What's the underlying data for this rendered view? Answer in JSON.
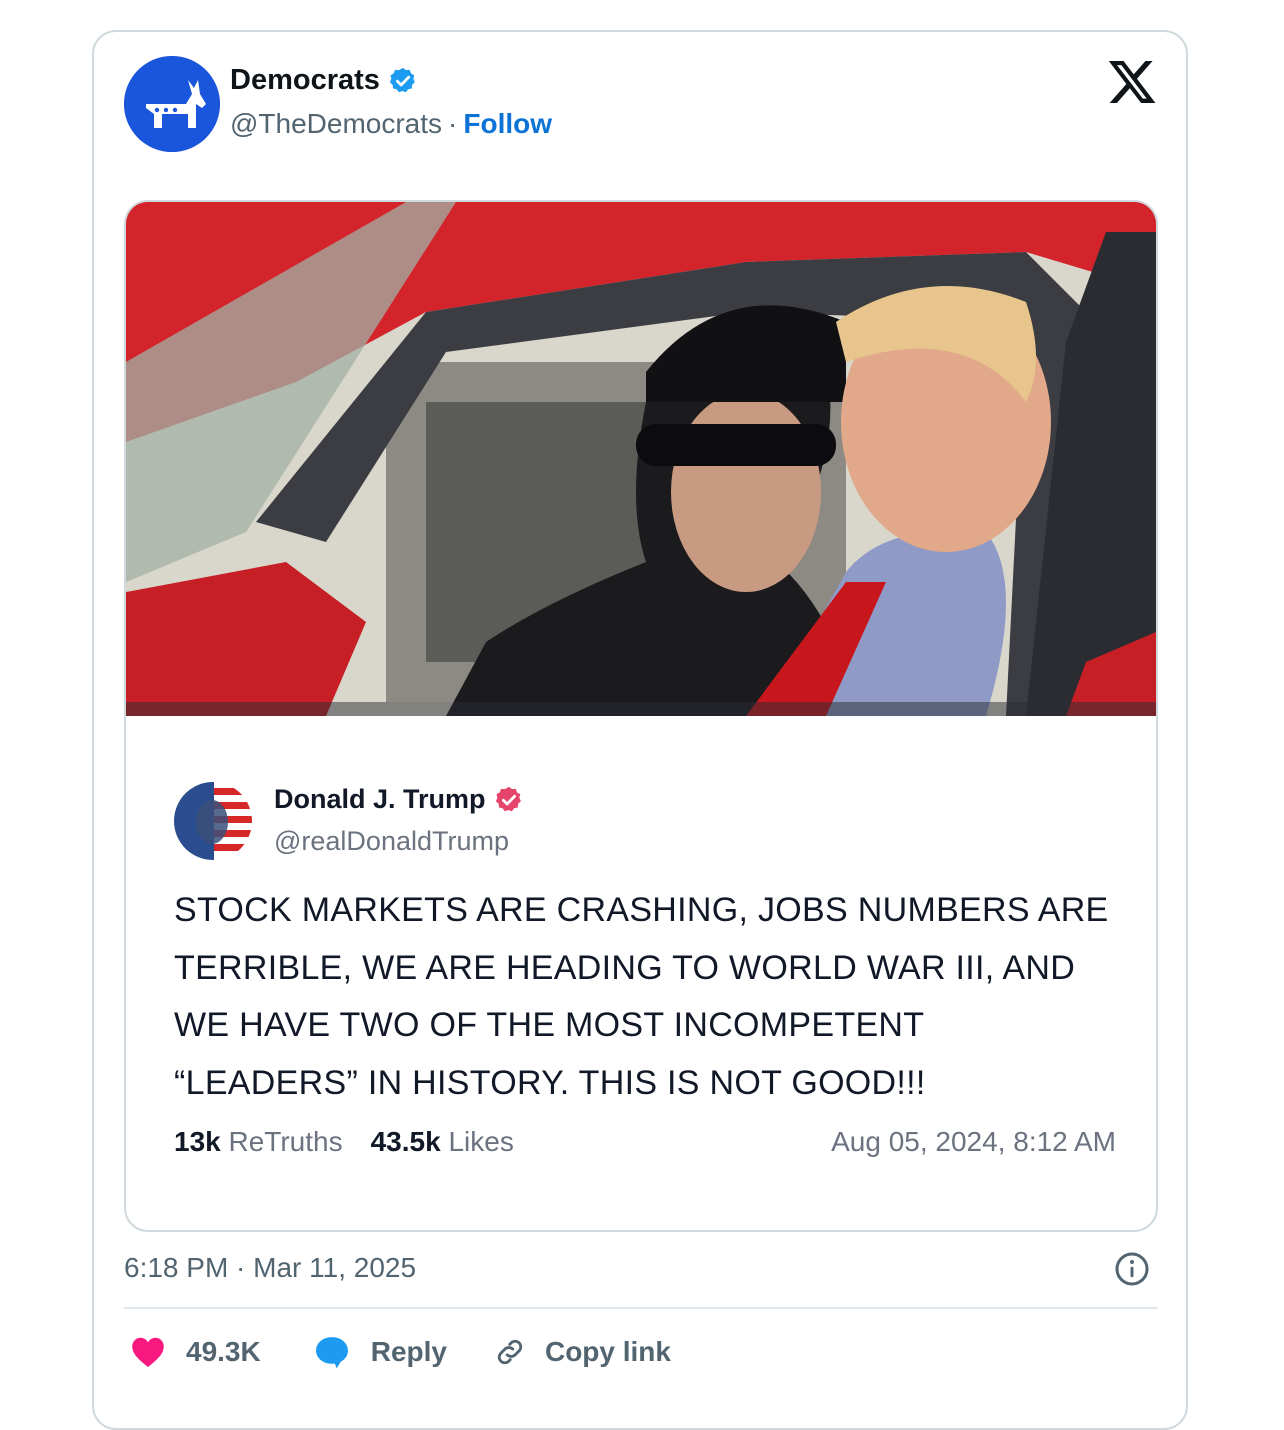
{
  "tweet": {
    "author_name": "Democrats",
    "author_handle": "@TheDemocrats",
    "separator": "·",
    "follow_label": "Follow",
    "timestamp": "6:18 PM · Mar 11, 2025",
    "likes_count": "49.3K",
    "reply_label": "Reply",
    "copy_link_label": "Copy link"
  },
  "quoted_post": {
    "author_name": "Donald J. Trump",
    "author_handle": "@realDonaldTrump",
    "text": "STOCK MARKETS ARE CRASHING, JOBS NUMBERS ARE TERRIBLE, WE ARE HEADING TO WORLD WAR III, AND WE HAVE TWO OF THE MOST INCOMPETENT “LEADERS” IN HISTORY. THIS IS NOT GOOD!!!",
    "retruths_count": "13k",
    "retruths_label": "ReTruths",
    "likes_count": "43.5k",
    "likes_label": "Likes",
    "date": "Aug 05, 2024, 8:12 AM"
  },
  "colors": {
    "verified_blue": "#1d9bf0",
    "truth_badge": "#e5456b",
    "like_heart": "#f91880",
    "brand_blue": "#1d4ed8"
  },
  "icons": [
    "donkey-logo-icon",
    "verified-badge-icon",
    "x-logo-icon",
    "info-icon",
    "heart-icon",
    "reply-bubble-icon",
    "link-icon"
  ]
}
